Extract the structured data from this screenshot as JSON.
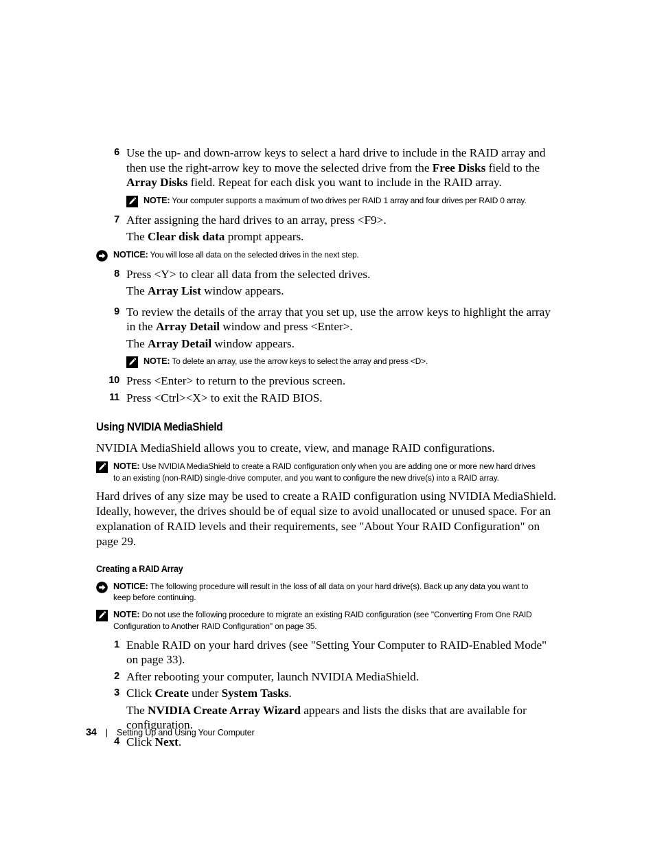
{
  "page": {
    "number": "34",
    "footer_separator": "|",
    "footer_title": "Setting Up and Using Your Computer"
  },
  "labels": {
    "note": "NOTE:",
    "notice": "NOTICE:"
  },
  "icons": {
    "note": "pencil-note-icon",
    "notice": "arrow-notice-icon"
  },
  "steps": {
    "s6_num": "6",
    "s6_a": "Use the up- and down-arrow keys to select a hard drive to include in the RAID array and then use the right-arrow key to move the selected drive from the ",
    "s6_b1": "Free Disks",
    "s6_b": " field to the ",
    "s6_b2": "Array Disks",
    "s6_c": " field. Repeat for each disk you want to include in the RAID array.",
    "note1": "Your computer supports a maximum of two drives per RAID 1 array and four drives per RAID 0 array.",
    "s7_num": "7",
    "s7_a": "After assigning the hard drives to an array, press <F9>.",
    "s7_sub_a": "The ",
    "s7_sub_b": "Clear disk data",
    "s7_sub_c": " prompt appears.",
    "notice1": "You will lose all data on the selected drives in the next step.",
    "s8_num": "8",
    "s8_a": "Press <Y> to clear all data from the selected drives.",
    "s8_sub_a": "The ",
    "s8_sub_b": "Array List",
    "s8_sub_c": " window appears.",
    "s9_num": "9",
    "s9_a": "To review the details of the array that you set up, use the arrow keys to highlight the array in the ",
    "s9_b": "Array Detail",
    "s9_c": " window and press <Enter>.",
    "s9_sub_a": "The ",
    "s9_sub_b": "Array Detail",
    "s9_sub_c": " window appears.",
    "note2": "To delete an array, use the arrow keys to select the array and press <D>.",
    "s10_num": "10",
    "s10_a": "Press <Enter> to return to the previous screen.",
    "s11_num": "11",
    "s11_a": "Press <Ctrl><X> to exit the RAID BIOS."
  },
  "section": {
    "heading": "Using NVIDIA MediaShield",
    "intro": "NVIDIA MediaShield allows you to create, view, and manage RAID configurations.",
    "note3": "Use NVIDIA MediaShield to create a RAID configuration only when you are adding one or more new hard drives to an existing (non-RAID) single-drive computer, and you want to configure the new drive(s) into a RAID array.",
    "body": "Hard drives of any size may be used to create a RAID configuration using NVIDIA MediaShield. Ideally, however, the drives should be of equal size to avoid unallocated or unused space. For an explanation of RAID levels and their requirements, see \"About Your RAID Configuration\" on page 29.",
    "subheading": "Creating a RAID Array",
    "notice2": "The following procedure will result in the loss of all data on your hard drive(s). Back up any data you want to keep before continuing.",
    "note4": "Do not use the following procedure to migrate an existing RAID configuration (see \"Converting From One RAID Configuration to Another RAID Configuration\" on page 35.",
    "c1_num": "1",
    "c1_a": "Enable RAID on your hard drives (see \"Setting Your Computer to RAID-Enabled Mode\" on page 33).",
    "c2_num": "2",
    "c2_a": "After rebooting your computer, launch NVIDIA MediaShield.",
    "c3_num": "3",
    "c3_a": "Click ",
    "c3_b1": "Create",
    "c3_b": " under ",
    "c3_b2": "System Tasks",
    "c3_c": ".",
    "c3_sub_a": "The ",
    "c3_sub_b": "NVIDIA Create Array Wizard",
    "c3_sub_c": " appears and lists the disks that are available for configuration.",
    "c4_num": "4",
    "c4_a": "Click ",
    "c4_b": "Next",
    "c4_c": "."
  }
}
